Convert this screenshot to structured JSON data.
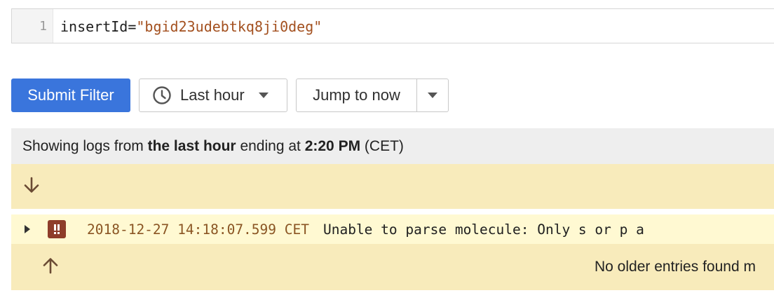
{
  "editor": {
    "line_number": "1",
    "query_key": "insertId=",
    "query_value": "\"bgid23udebtkq8ji0deg\""
  },
  "toolbar": {
    "submit_label": "Submit Filter",
    "time_range_label": "Last hour",
    "jump_label": "Jump to now"
  },
  "status": {
    "prefix": "Showing logs from ",
    "range": "the last hour",
    "middle": " ending at ",
    "time": "2:20 PM",
    "suffix": " (CET)"
  },
  "log_entries": [
    {
      "severity": "error",
      "timestamp": "2018-12-27 14:18:07.599 CET",
      "message": "Unable to parse molecule: Only s or p a"
    }
  ],
  "footer": {
    "no_older_text": "No older entries found m"
  },
  "icons": {
    "load_newer": "arrow-down-icon",
    "load_older": "arrow-up-icon",
    "time": "clock-icon",
    "severity": "error-severity-icon"
  },
  "colors": {
    "primary": "#3a75dc",
    "log_band": "#f8ebbb",
    "log_row": "#fff9d2",
    "severity_error": "#8e3d2a",
    "timestamp": "#8a5523",
    "string_literal": "#a3501f"
  }
}
